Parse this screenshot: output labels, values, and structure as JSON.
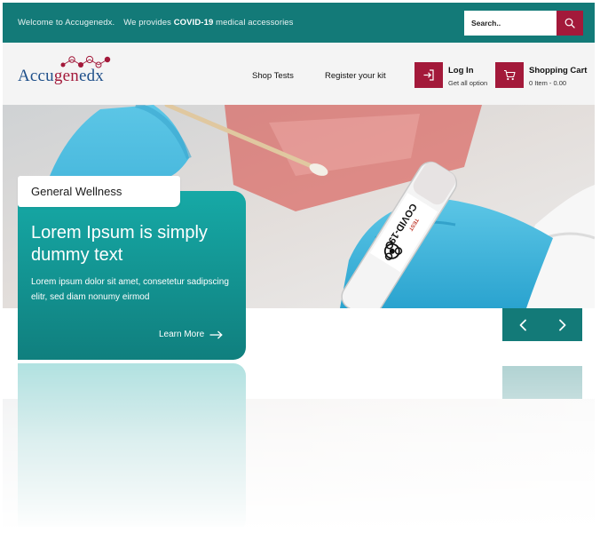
{
  "topbar": {
    "welcome_prefix": "Welcome to Accugenedx.",
    "welcome_middle": "We provides",
    "welcome_bold": "COVID-19",
    "welcome_suffix": "medical accessories",
    "search_placeholder": "Search..",
    "search_icon": "search-icon"
  },
  "header": {
    "logo_prefix": "Accu",
    "logo_accent": "gen",
    "logo_suffix": "edx",
    "nav": [
      "Shop Tests",
      "Register your kit"
    ],
    "login_title": "Log In",
    "login_sub": "Get all option",
    "login_icon": "login-icon",
    "cart_title": "Shopping Cart",
    "cart_sub": "0 Item - 0.00",
    "cart_icon": "cart-icon"
  },
  "hero": {
    "tag": "General Wellness",
    "title": "Lorem Ipsum is simply dummy text",
    "description": "Lorem ipsum dolor sit amet, consetetur sadipscing elitr, sed diam nonumy eirmod",
    "link": "Learn More",
    "tube_label": "COVID-19",
    "tube_sub": "TEST",
    "prev_icon": "chevron-left-icon",
    "next_icon": "chevron-right-icon"
  },
  "colors": {
    "teal": "#137a78",
    "crimson": "#a3193a",
    "card_gradient_top": "#16a9a6",
    "logo_blue": "#1e4f8a"
  }
}
